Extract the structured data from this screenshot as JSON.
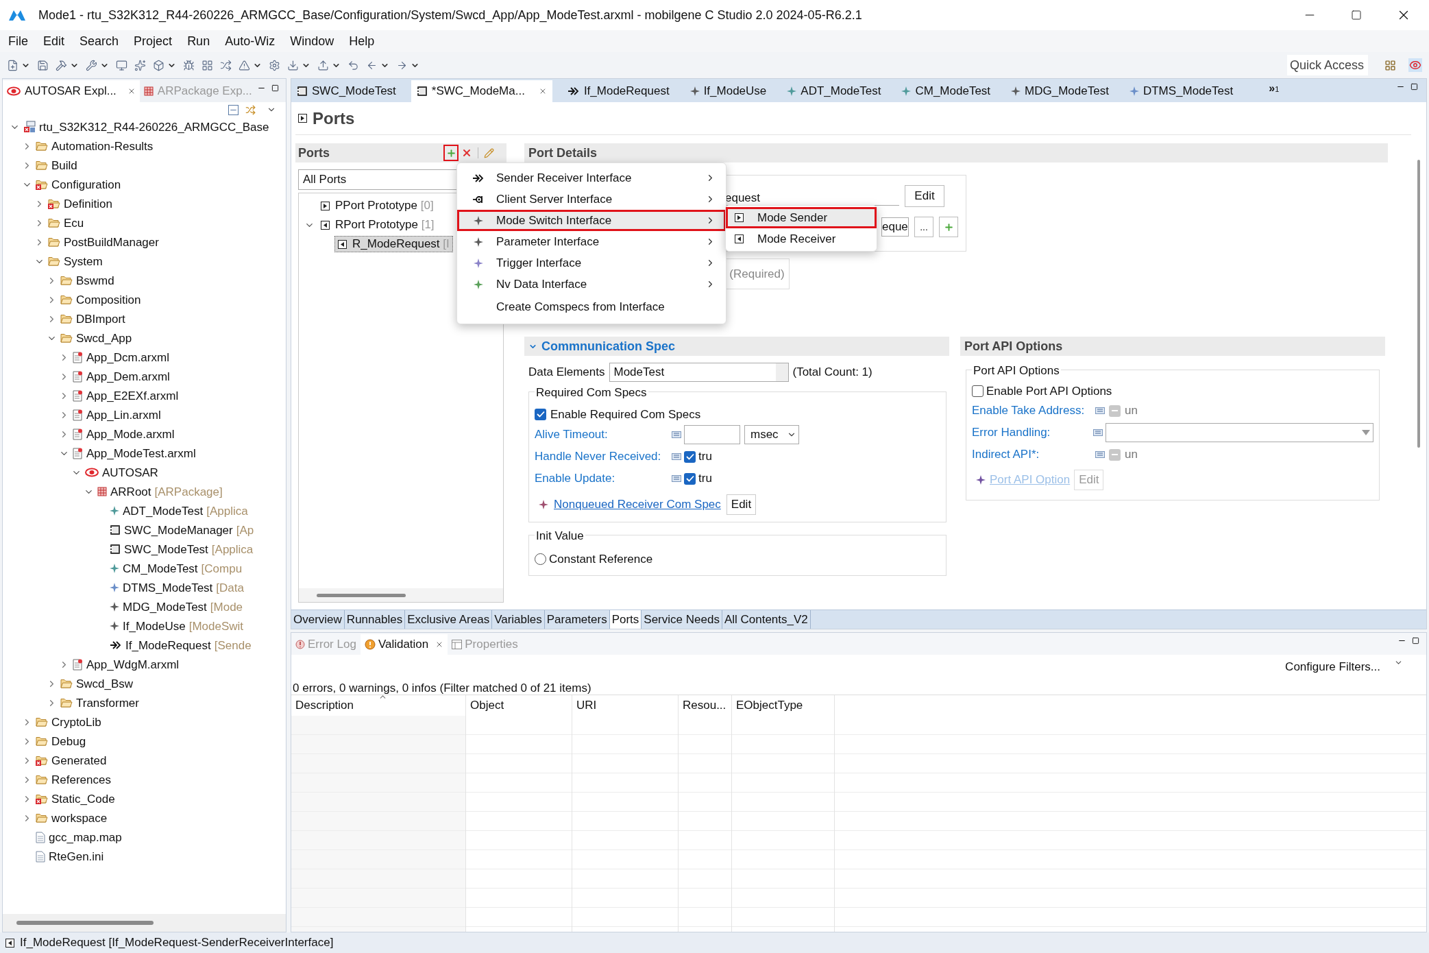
{
  "window": {
    "title": "Mode1 - rtu_S32K312_R44-260226_ARMGCC_Base/Configuration/System/Swcd_App/App_ModeTest.arxml - mobilgene C Studio 2.0 2024-05-R6.2.1"
  },
  "menu_bar": [
    "File",
    "Edit",
    "Search",
    "Project",
    "Run",
    "Auto-Wiz",
    "Window",
    "Help"
  ],
  "quick_access": {
    "placeholder": "Quick Access"
  },
  "explorer": {
    "tabs": [
      {
        "label": "AUTOSAR Expl...",
        "kind": "autosar",
        "selected": true
      },
      {
        "label": "ARPackage Exp...",
        "kind": "package",
        "selected": false
      }
    ],
    "tree": [
      {
        "label": "rtu_S32K312_R44-260226_ARMGCC_Base",
        "kind": "project",
        "expanded": true,
        "children": [
          {
            "label": "Automation-Results",
            "kind": "folder",
            "expanded": false
          },
          {
            "label": "Build",
            "kind": "folder",
            "expanded": false
          },
          {
            "label": "Configuration",
            "kind": "error_folder",
            "expanded": true,
            "children": [
              {
                "label": "Definition",
                "kind": "error_folder",
                "expanded": false
              },
              {
                "label": "Ecu",
                "kind": "folder",
                "expanded": false
              },
              {
                "label": "PostBuildManager",
                "kind": "folder",
                "expanded": false
              },
              {
                "label": "System",
                "kind": "folder",
                "expanded": true,
                "children": [
                  {
                    "label": "Bswmd",
                    "kind": "folder",
                    "expanded": false
                  },
                  {
                    "label": "Composition",
                    "kind": "folder",
                    "expanded": false
                  },
                  {
                    "label": "DBImport",
                    "kind": "folder",
                    "expanded": false
                  },
                  {
                    "label": "Swcd_App",
                    "kind": "folder",
                    "expanded": true,
                    "children": [
                      {
                        "label": "App_Dcm.arxml",
                        "kind": "file",
                        "expanded": false
                      },
                      {
                        "label": "App_Dem.arxml",
                        "kind": "file",
                        "expanded": false
                      },
                      {
                        "label": "App_E2EXf.arxml",
                        "kind": "file",
                        "expanded": false
                      },
                      {
                        "label": "App_Lin.arxml",
                        "kind": "file",
                        "expanded": false
                      },
                      {
                        "label": "App_Mode.arxml",
                        "kind": "file",
                        "expanded": false
                      },
                      {
                        "label": "App_ModeTest.arxml",
                        "kind": "file",
                        "expanded": true,
                        "children": [
                          {
                            "label": "AUTOSAR",
                            "kind": "autosar",
                            "expanded": true,
                            "children": [
                              {
                                "label": "ARRoot",
                                "suffix": "[ARPackage]",
                                "kind": "package",
                                "expanded": true,
                                "children": [
                                  {
                                    "label": "ADT_ModeTest",
                                    "suffix": "[Applica",
                                    "kind": "element",
                                    "color": "#4f9a9a"
                                  },
                                  {
                                    "label": "SWC_ModeManager",
                                    "suffix": "[Ap",
                                    "kind": "component"
                                  },
                                  {
                                    "label": "SWC_ModeTest",
                                    "suffix": "[Applica",
                                    "kind": "component"
                                  },
                                  {
                                    "label": "CM_ModeTest",
                                    "suffix": "[Compu",
                                    "kind": "element",
                                    "color": "#4f9a9a"
                                  },
                                  {
                                    "label": "DTMS_ModeTest",
                                    "suffix": "[Data",
                                    "kind": "element",
                                    "color": "#6a8ec8"
                                  },
                                  {
                                    "label": "MDG_ModeTest",
                                    "suffix": "[Mode",
                                    "kind": "element",
                                    "color": "#5a5a5a"
                                  },
                                  {
                                    "label": "If_ModeUse",
                                    "suffix": "[ModeSwit",
                                    "kind": "element",
                                    "color": "#5a5a5a"
                                  },
                                  {
                                    "label": "If_ModeRequest",
                                    "suffix": "[Sende",
                                    "kind": "sender"
                                  }
                                ]
                              }
                            ]
                          }
                        ]
                      },
                      {
                        "label": "App_WdgM.arxml",
                        "kind": "file",
                        "expanded": false
                      }
                    ]
                  },
                  {
                    "label": "Swcd_Bsw",
                    "kind": "folder",
                    "expanded": false
                  },
                  {
                    "label": "Transformer",
                    "kind": "folder",
                    "expanded": false
                  }
                ]
              }
            ]
          },
          {
            "label": "CryptoLib",
            "kind": "folder",
            "expanded": false
          },
          {
            "label": "Debug",
            "kind": "folder",
            "expanded": false
          },
          {
            "label": "Generated",
            "kind": "error_folder",
            "expanded": false
          },
          {
            "label": "References",
            "kind": "folder",
            "expanded": false
          },
          {
            "label": "Static_Code",
            "kind": "error_folder",
            "expanded": false
          },
          {
            "label": "workspace",
            "kind": "folder",
            "expanded": false
          },
          {
            "label": "gcc_map.map",
            "kind": "text_file"
          },
          {
            "label": "RteGen.ini",
            "kind": "text_file"
          }
        ]
      }
    ]
  },
  "editor_tabs": [
    {
      "label": "SWC_ModeTest",
      "kind": "component",
      "selected": false
    },
    {
      "label": "*SWC_ModeMa...",
      "kind": "component",
      "selected": true
    },
    {
      "label": "If_ModeRequest",
      "kind": "sender",
      "selected": false
    },
    {
      "label": "If_ModeUse",
      "kind": "element",
      "color": "#5a5a5a",
      "selected": false
    },
    {
      "label": "ADT_ModeTest",
      "kind": "element",
      "color": "#4f9a9a",
      "selected": false
    },
    {
      "label": "CM_ModeTest",
      "kind": "element",
      "color": "#4f9a9a",
      "selected": false
    },
    {
      "label": "MDG_ModeTest",
      "kind": "element",
      "color": "#5a5a5a",
      "selected": false
    },
    {
      "label": "DTMS_ModeTest",
      "kind": "element",
      "color": "#6a8ec8",
      "selected": false
    }
  ],
  "editor_overflow": {
    "mark": "»",
    "count": "1"
  },
  "page_title": "Ports",
  "ports": {
    "title": "Ports",
    "add_highlighted": true,
    "filter": "All Ports",
    "tree": [
      {
        "label": "PPort Prototype",
        "count": "[0]",
        "kind": "provided",
        "selected": false
      },
      {
        "label": "RPort Prototype",
        "count": "[1]",
        "kind": "required",
        "expanded": true,
        "selected": false,
        "children": [
          {
            "label": "R_ModeRequest",
            "count": "[I",
            "kind": "required",
            "selected": true
          }
        ]
      }
    ]
  },
  "context_menu": [
    {
      "label": "Sender Receiver Interface",
      "kind": "sender",
      "submenu": true,
      "selected": false
    },
    {
      "label": "Client Server Interface",
      "kind": "client",
      "submenu": true,
      "selected": false
    },
    {
      "label": "Mode Switch Interface",
      "kind": "element",
      "color": "#5a5a5a",
      "submenu": true,
      "selected": true
    },
    {
      "label": "Parameter Interface",
      "kind": "element",
      "color": "#5a5a5a",
      "submenu": true,
      "selected": false
    },
    {
      "label": "Trigger Interface",
      "kind": "element",
      "color": "#8a82c8",
      "submenu": true,
      "selected": false
    },
    {
      "label": "Nv Data Interface",
      "kind": "element",
      "color": "#5aa05a",
      "submenu": true,
      "selected": false
    },
    {
      "label": "Create Comspecs from Interface",
      "kind": "none",
      "submenu": false,
      "selected": false
    }
  ],
  "submenu": [
    {
      "label": "Mode Sender",
      "kind": "provided",
      "selected": true
    },
    {
      "label": "Mode Receiver",
      "kind": "required",
      "selected": false
    }
  ],
  "port_details": {
    "title": "Port Details",
    "interface_value": "equest",
    "interface_button": "Edit",
    "type_value": "eque",
    "browse_button": "...",
    "required": "(Required)"
  },
  "communication_spec": {
    "title": "Commnunication Spec",
    "expanded": true,
    "data_elements": {
      "label": "Data Elements",
      "value": "ModeTest",
      "total": "(Total Count: 1)"
    },
    "required_com_specs": {
      "title": "Required Com Specs",
      "enable": {
        "label": "Enable Required Com Specs",
        "checked": true
      },
      "fields": [
        {
          "kind": "number_unit",
          "label": "Alive Timeout:",
          "unit": "msec"
        },
        {
          "kind": "checkbox",
          "label": "Handle Never Received:",
          "checked": true,
          "value": "tru"
        },
        {
          "kind": "checkbox",
          "label": "Enable Update:",
          "checked": true,
          "value": "tru"
        }
      ],
      "link": {
        "label": "Nonqueued Receiver Com Spec",
        "button": "Edit"
      }
    },
    "init_value": {
      "title": "Init Value",
      "options": [
        {
          "label": "Constant Reference",
          "selected": false
        }
      ]
    }
  },
  "port_api": {
    "header": "Port API Options",
    "group_title": "Port API Options",
    "enable": {
      "label": "Enable Port API Options",
      "checked": false
    },
    "fields": [
      {
        "kind": "checkbox",
        "label": "Enable Take Address:",
        "disabled": true,
        "value": "un"
      },
      {
        "kind": "dropdown",
        "label": "Error Handling:"
      },
      {
        "kind": "checkbox",
        "label": "Indirect API*:",
        "disabled": true,
        "value": "un"
      }
    ],
    "link": {
      "label": "Port API Option",
      "button": "Edit",
      "disabled": true
    }
  },
  "page_tabs": [
    {
      "label": "Overview",
      "selected": false
    },
    {
      "label": "Runnables",
      "selected": false
    },
    {
      "label": "Exclusive Areas",
      "selected": false
    },
    {
      "label": "Variables",
      "selected": false
    },
    {
      "label": "Parameters",
      "selected": false
    },
    {
      "label": "Ports",
      "selected": true
    },
    {
      "label": "Service Needs",
      "selected": false
    },
    {
      "label": "All Contents_V2",
      "selected": false
    }
  ],
  "views": {
    "tabs": [
      {
        "label": "Error Log",
        "kind": "log",
        "selected": false
      },
      {
        "label": "Validation",
        "kind": "warning",
        "selected": true
      },
      {
        "label": "Properties",
        "kind": "properties",
        "selected": false
      }
    ],
    "configure": "Configure Filters...",
    "summary": "0 errors, 0 warnings, 0 infos (Filter matched 0 of 21 items)",
    "columns": [
      {
        "label": "Description",
        "sorted": true
      },
      {
        "label": "Object",
        "sorted": false
      },
      {
        "label": "URI",
        "sorted": false
      },
      {
        "label": "Resou...",
        "sorted": false
      },
      {
        "label": "EObjectType",
        "sorted": false
      }
    ]
  },
  "status_bar": "If_ModeRequest [If_ModeRequest-SenderReceiverInterface]"
}
